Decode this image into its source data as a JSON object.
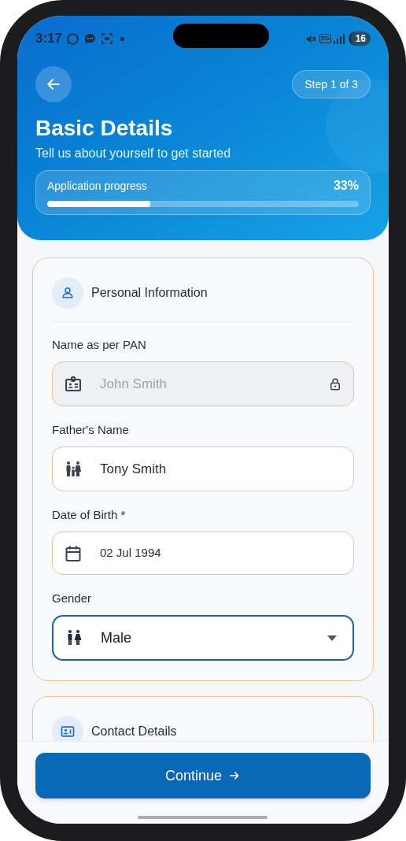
{
  "status_bar": {
    "time": "3:17",
    "network": "5G",
    "battery": "16"
  },
  "header": {
    "step": "Step 1 of 3",
    "title": "Basic Details",
    "subtitle": "Tell us about yourself to get started",
    "progress": {
      "label": "Application progress",
      "percent": "33%",
      "level": 0.33
    }
  },
  "sections": [
    {
      "title": "Personal Information",
      "fields": [
        {
          "label": "Name as per PAN",
          "value": "John Smith",
          "kind": "text",
          "disabled": true,
          "focused": false
        },
        {
          "label": "Father's Name",
          "value": "Tony Smith",
          "kind": "text",
          "disabled": false,
          "focused": false
        },
        {
          "label": "Date of Birth *",
          "value": "02 Jul 1994",
          "kind": "date",
          "disabled": false,
          "focused": false
        },
        {
          "label": "Gender",
          "value": "Male",
          "kind": "select",
          "disabled": false,
          "focused": true
        }
      ]
    },
    {
      "title": "Contact Details"
    }
  ],
  "primary_button": {
    "label": "Continue"
  }
}
